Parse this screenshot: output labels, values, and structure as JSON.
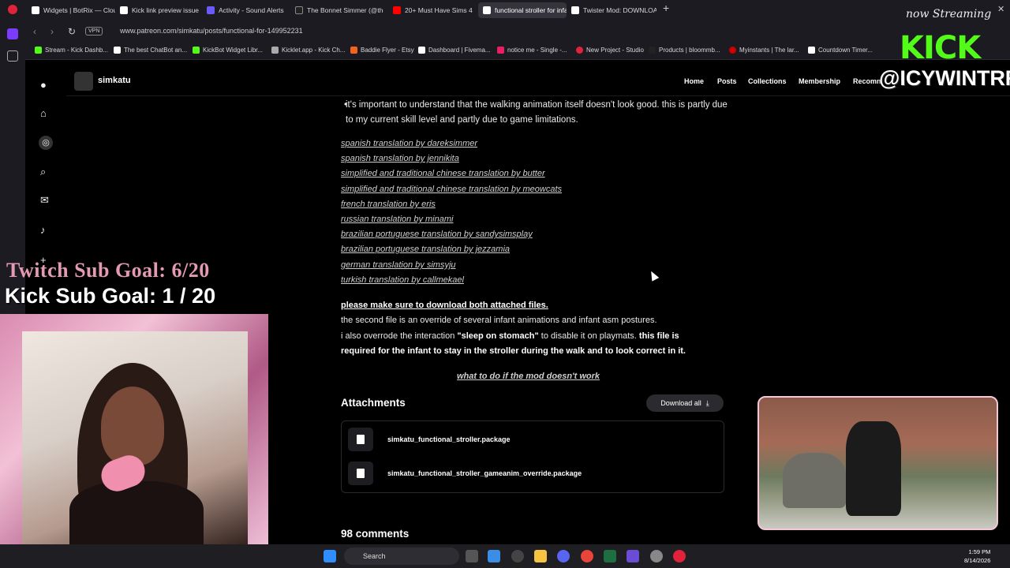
{
  "browser": {
    "tabs": [
      {
        "label": "Widgets | BotRix — Cloud",
        "color": "#ffffff"
      },
      {
        "label": "Kick link preview issue",
        "color": "#ffffff"
      },
      {
        "label": "Activity - Sound Alerts",
        "color": "#6a5af9"
      },
      {
        "label": "The Bonnet Simmer (@the",
        "color": "#000000"
      },
      {
        "label": "20+ Must Have Sims 4",
        "color": "#ff0000"
      },
      {
        "label": "functional stroller for infa",
        "color": "#ffffff"
      },
      {
        "label": "Twister Mod: DOWNLOAD",
        "color": "#ffffff"
      }
    ],
    "url": "www.patreon.com/simkatu/posts/functional-for-149952231",
    "vpn_label": "VPN",
    "bookmarks": [
      "Stream - Kick Dashb...",
      "The best ChatBot an...",
      "KickBot Widget Libr...",
      "Kicklet.app - Kick Ch...",
      "Baddie Flyer - Etsy",
      "Dashboard | Fivema...",
      "notice me - Single -...",
      "New Project - Studio",
      "Products | bloommb...",
      "Myinstants | The lar...",
      "Countdown Timer..."
    ]
  },
  "patreon": {
    "creator": "simkatu",
    "nav": [
      "Home",
      "Posts",
      "Collections",
      "Membership",
      "Recomm"
    ]
  },
  "post": {
    "bullet": "it's important to understand that the walking animation itself doesn't look good. this is partly due to my current skill level and partly due to game limitations.",
    "translations": [
      "spanish translation by dareksimmer",
      "spanish translation by jennikita",
      "simplified and traditional chinese translation by butter",
      "simplified and traditional chinese translation by meowcats",
      "french translation by eris",
      "russian translation by minami",
      "brazilian portuguese translation by sandysimsplay",
      "brazilian portuguese translation by jezzamia",
      "german translation by simsyju",
      "turkish translation by callmekael"
    ],
    "notice_bold": "please make sure to download both attached files.",
    "para1": "the second file is an override of several infant animations and infant asm postures.",
    "para2_a": "i also overrode the interaction ",
    "para2_b": "\"sleep on stomach\"",
    "para2_c": " to disable it on playmats. ",
    "para2_d": "this file is",
    "para3": "required for the infant to stay in the stroller during the walk and to look correct in it.",
    "help_link": "what to do if the mod doesn't work",
    "attachments_title": "Attachments",
    "download_all": "Download all",
    "files": [
      "simkatu_functional_stroller.package",
      "simkatu_functional_stroller_gameanim_override.package"
    ],
    "comments": "98 comments"
  },
  "overlay": {
    "twitch_goal": "Twitch Sub Goal: 6/20",
    "kick_goal": "Kick Sub Goal: 1 / 20",
    "now_streaming": "now Streaming",
    "kick_logo": "KICK",
    "handle": "@ICYWINTRR"
  },
  "taskbar": {
    "search": "Search",
    "time": "1:59 PM",
    "date": "8/14/2026"
  }
}
